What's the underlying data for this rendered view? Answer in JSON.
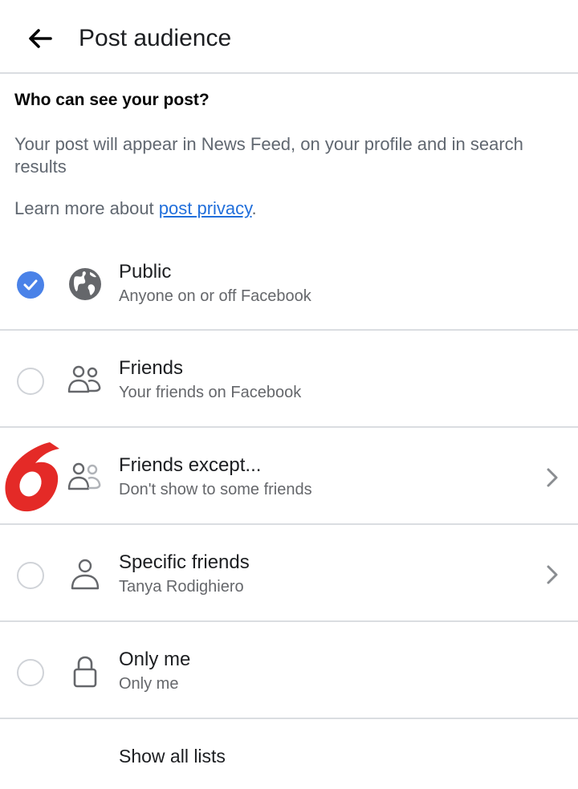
{
  "header": {
    "title": "Post audience",
    "back_icon": "arrow-left-icon"
  },
  "intro": {
    "heading": "Who can see your post?",
    "description": "Your post will appear in News Feed, on your profile and in search results",
    "learn_prefix": "Learn more about ",
    "learn_link": "post privacy",
    "learn_suffix": "."
  },
  "options": [
    {
      "title": "Public",
      "subtitle": "Anyone on or off Facebook",
      "icon": "globe-icon",
      "selected": true,
      "has_chevron": false
    },
    {
      "title": "Friends",
      "subtitle": "Your friends on Facebook",
      "icon": "friends-icon",
      "selected": false,
      "has_chevron": false
    },
    {
      "title": "Friends except...",
      "subtitle": "Don't show to some friends",
      "icon": "friends-except-icon",
      "selected": false,
      "has_chevron": true
    },
    {
      "title": "Specific friends",
      "subtitle": "Tanya Rodighiero",
      "icon": "person-icon",
      "selected": false,
      "has_chevron": true
    },
    {
      "title": "Only me",
      "subtitle": "Only me",
      "icon": "lock-icon",
      "selected": false,
      "has_chevron": false
    }
  ],
  "footer": {
    "show_all_label": "Show all lists"
  },
  "colors": {
    "accent": "#4a82e8",
    "link": "#216fdb",
    "divider": "#dadde1",
    "logo_red": "#e42a27"
  }
}
